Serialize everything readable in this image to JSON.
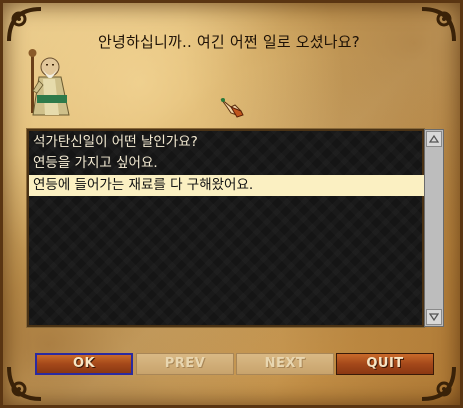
{
  "dialog": {
    "greeting": "안녕하십니까.. 여긴 어쩐 일로 오셨나요?",
    "npc_portrait_icon": "old-monk-portrait",
    "cursor_icon": "hand-pointer-icon"
  },
  "options": [
    {
      "label": "석가탄신일이 어떤 날인가요?",
      "selected": false
    },
    {
      "label": "연등을 가지고 싶어요.",
      "selected": false
    },
    {
      "label": "연등에 들어가는 재료를 다 구해왔어요.",
      "selected": true
    }
  ],
  "scrollbar": {
    "up_icon": "scroll-up-arrow-icon",
    "down_icon": "scroll-down-arrow-icon"
  },
  "buttons": {
    "ok": "OK",
    "prev": "PREV",
    "next": "NEXT",
    "quit": "QUIT"
  }
}
